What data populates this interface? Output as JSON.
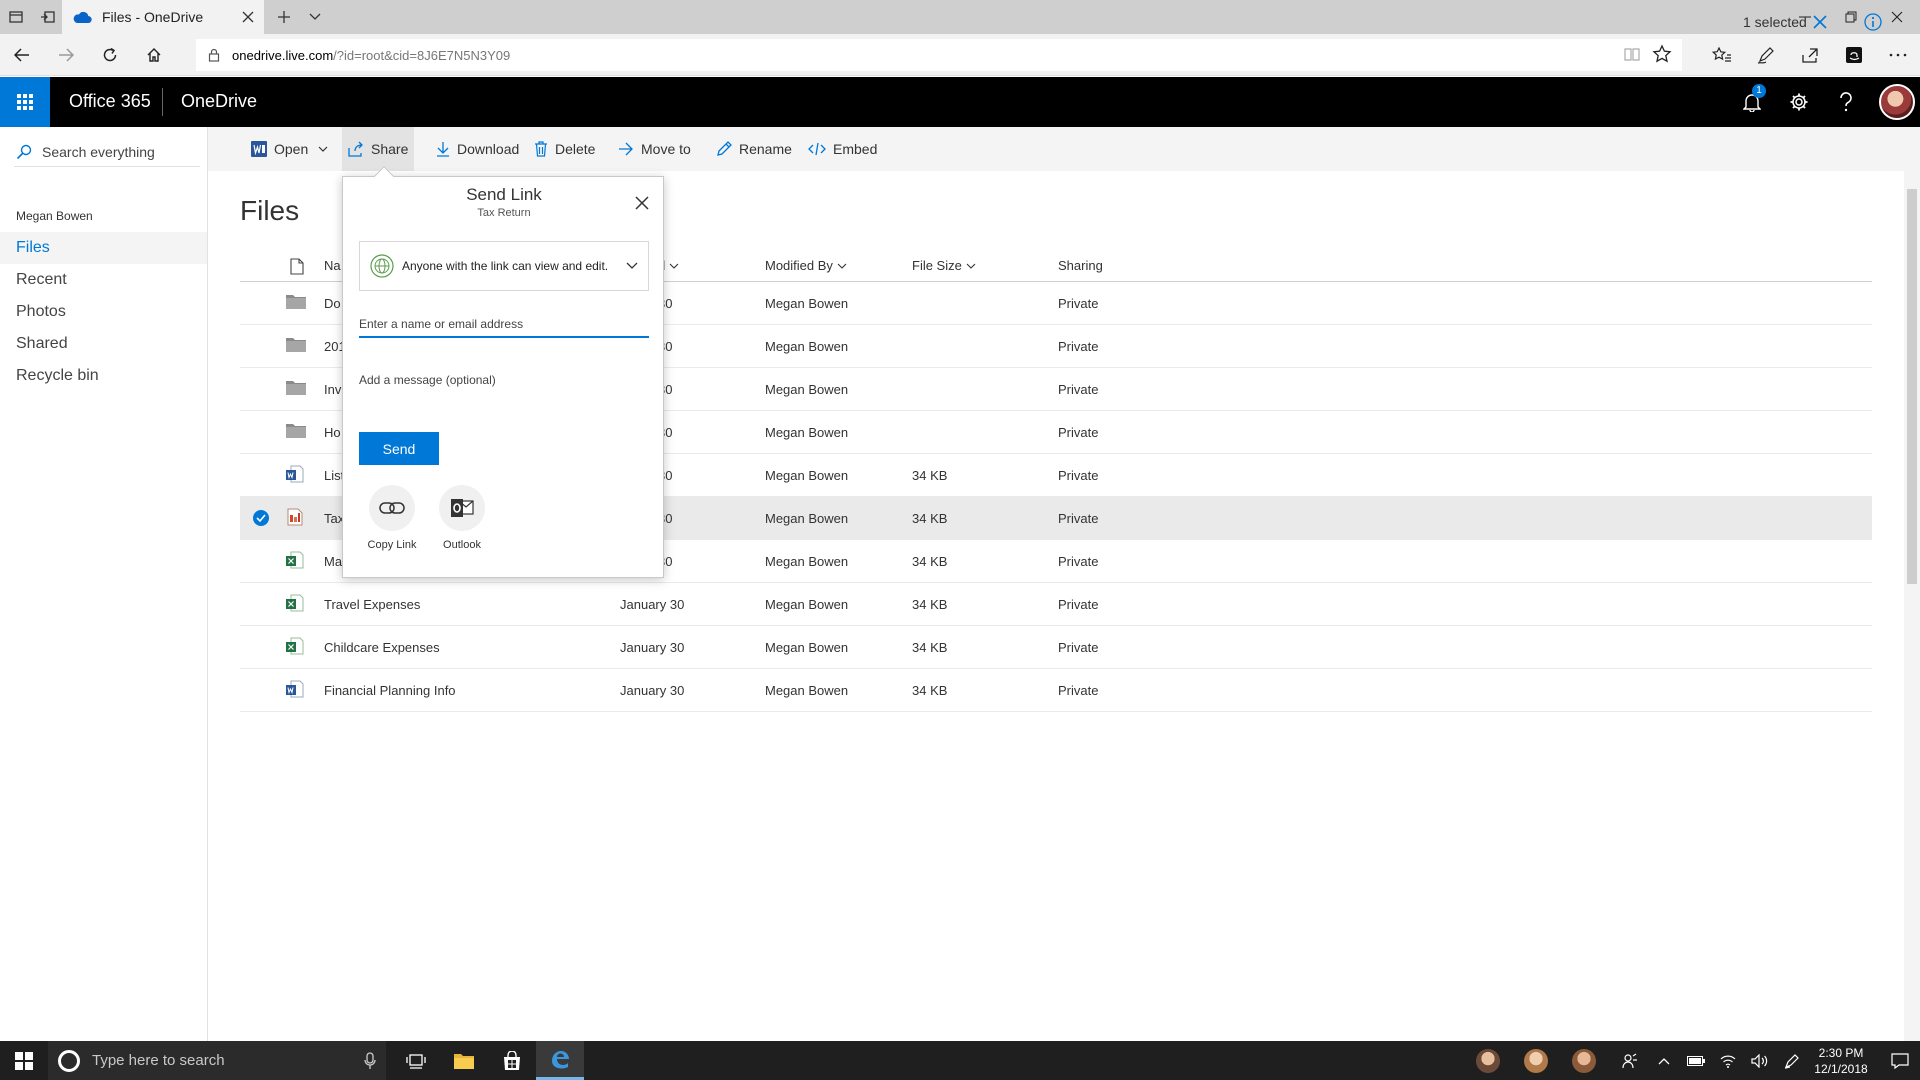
{
  "browser": {
    "tab_title": "Files - OneDrive",
    "url_host": "onedrive.live.com",
    "url_path": "/?id=root&cid=8J6E7N5N3Y09"
  },
  "suite": {
    "brand": "Office 365",
    "app_name": "OneDrive",
    "notification_count": "1"
  },
  "nav": {
    "search_placeholder": "Search everything",
    "user_name": "Megan Bowen",
    "items": [
      {
        "label": "Files"
      },
      {
        "label": "Recent"
      },
      {
        "label": "Photos"
      },
      {
        "label": "Shared"
      },
      {
        "label": "Recycle bin"
      }
    ]
  },
  "commands": {
    "open": "Open",
    "share": "Share",
    "download": "Download",
    "delete": "Delete",
    "move_to": "Move to",
    "rename": "Rename",
    "embed": "Embed",
    "selection": "1 selected"
  },
  "page": {
    "title": "Files"
  },
  "columns": {
    "name": "Na",
    "modified": "d",
    "modified_by": "Modified By",
    "file_size": "File Size",
    "sharing": "Sharing"
  },
  "files": [
    {
      "name": "Do",
      "modified": "30",
      "modified_by": "Megan Bowen",
      "size": "",
      "sharing": "Private"
    },
    {
      "name": "201",
      "modified": "30",
      "modified_by": "Megan Bowen",
      "size": "",
      "sharing": "Private"
    },
    {
      "name": "Inv",
      "modified": "30",
      "modified_by": "Megan Bowen",
      "size": "",
      "sharing": "Private"
    },
    {
      "name": "Ho",
      "modified": "30",
      "modified_by": "Megan Bowen",
      "size": "",
      "sharing": "Private"
    },
    {
      "name": "List",
      "modified": "30",
      "modified_by": "Megan Bowen",
      "size": "34 KB",
      "sharing": "Private"
    },
    {
      "name": "Tax",
      "modified": "30",
      "modified_by": "Megan Bowen",
      "size": "34 KB",
      "sharing": "Private"
    },
    {
      "name": "Ma",
      "modified": "30",
      "modified_by": "Megan Bowen",
      "size": "34 KB",
      "sharing": "Private"
    },
    {
      "name": "Travel Expenses",
      "modified": "January 30",
      "modified_by": "Megan Bowen",
      "size": "34 KB",
      "sharing": "Private"
    },
    {
      "name": "Childcare Expenses",
      "modified": "January 30",
      "modified_by": "Megan Bowen",
      "size": "34 KB",
      "sharing": "Private"
    },
    {
      "name": "Financial Planning Info",
      "modified": "January 30",
      "modified_by": "Megan Bowen",
      "size": "34 KB",
      "sharing": "Private"
    }
  ],
  "dialog": {
    "title": "Send Link",
    "subtitle": "Tax Return",
    "permission": "Anyone with the link can view and edit.",
    "recipient_placeholder": "Enter a name or email address",
    "message_placeholder": "Add a message (optional)",
    "send_label": "Send",
    "copy_link": "Copy Link",
    "outlook": "Outlook"
  },
  "taskbar": {
    "search_placeholder": "Type here to search",
    "time": "2:30 PM",
    "date": "12/1/2018"
  },
  "colors": {
    "accent": "#0078d7",
    "suite_bg": "#000000",
    "excel_green": "#217346",
    "word_blue": "#2b579a"
  }
}
